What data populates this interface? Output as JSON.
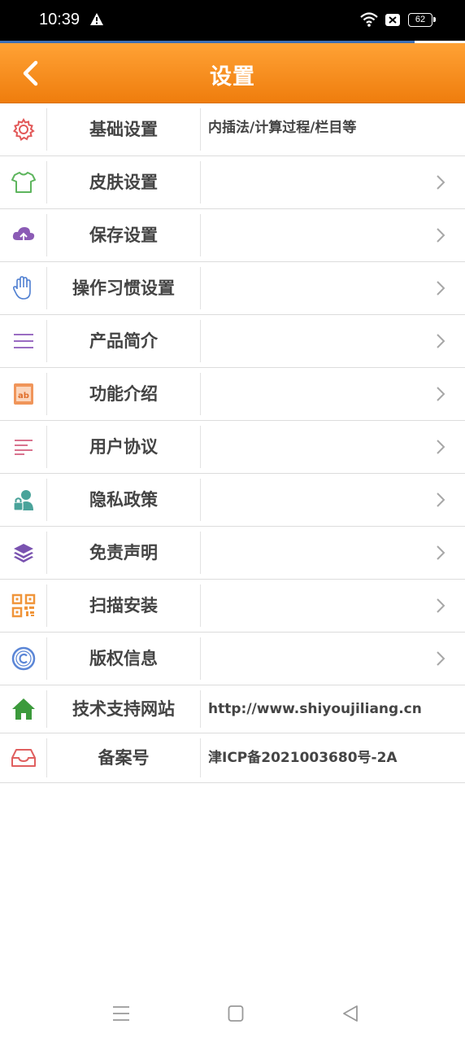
{
  "status": {
    "time": "10:39",
    "battery": "62"
  },
  "header": {
    "title": "设置"
  },
  "rows": [
    {
      "label": "基础设置",
      "value": "内插法/计算过程/栏目等",
      "icon": "gear-icon",
      "chevron": false
    },
    {
      "label": "皮肤设置",
      "value": "",
      "icon": "tshirt-icon",
      "chevron": true
    },
    {
      "label": "保存设置",
      "value": "",
      "icon": "cloud-upload-icon",
      "chevron": true
    },
    {
      "label": "操作习惯设置",
      "value": "",
      "icon": "hand-icon",
      "chevron": true
    },
    {
      "label": "产品简介",
      "value": "",
      "icon": "menu-lines-icon",
      "chevron": true
    },
    {
      "label": "功能介绍",
      "value": "",
      "icon": "ab-box-icon",
      "chevron": true
    },
    {
      "label": "用户协议",
      "value": "",
      "icon": "text-lines-icon",
      "chevron": true
    },
    {
      "label": "隐私政策",
      "value": "",
      "icon": "user-lock-icon",
      "chevron": true
    },
    {
      "label": "免责声明",
      "value": "",
      "icon": "layers-icon",
      "chevron": true
    },
    {
      "label": "扫描安装",
      "value": "",
      "icon": "qr-code-icon",
      "chevron": true
    },
    {
      "label": "版权信息",
      "value": "",
      "icon": "copyright-icon",
      "chevron": true
    },
    {
      "label": "技术支持网站",
      "value": "http://www.shiyoujiliang.cn",
      "icon": "home-icon",
      "chevron": false
    },
    {
      "label": "备案号",
      "value": "津ICP备2021003680号-2A",
      "icon": "inbox-icon",
      "chevron": false
    }
  ],
  "colors": {
    "accent": "#f7931e",
    "text": "#444444"
  }
}
